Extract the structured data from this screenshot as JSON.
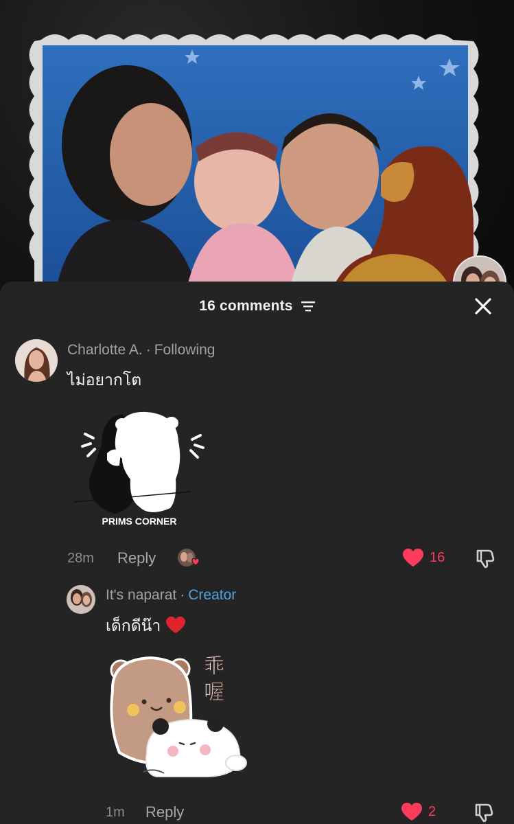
{
  "sheet": {
    "comment_count_label": "16 comments"
  },
  "comments": [
    {
      "author": "Charlotte A.",
      "relation": "Following",
      "text": "ไม่อยากโต",
      "sticker_caption": "PRIMS CORNER",
      "time": "28m",
      "reply_label": "Reply",
      "likes": "16"
    },
    {
      "author": "It's naparat",
      "relation": "Creator",
      "text": "เด็กดีน๊า",
      "sticker_chars": [
        "乖",
        "喔"
      ],
      "time": "1m",
      "reply_label": "Reply",
      "likes": "2"
    }
  ],
  "colors": {
    "accent_like": "#ff3b5c",
    "creator_tag": "#4ba3e3",
    "sheet_bg": "#242424"
  }
}
